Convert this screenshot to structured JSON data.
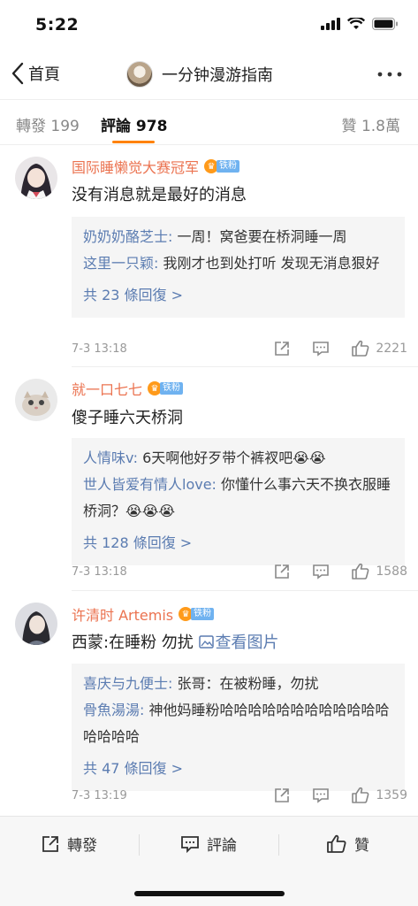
{
  "status": {
    "time": "5:22"
  },
  "nav": {
    "back_label": "首頁",
    "title": "一分钟漫游指南"
  },
  "tabs": {
    "repost": "轉發 199",
    "comments": "評論 978",
    "likes": "贊 1.8萬"
  },
  "comments": [
    {
      "name": "国际睡懒觉大赛冠军",
      "badge": "铁粉",
      "text": "没有消息就是最好的消息",
      "replies": [
        {
          "user": "奶奶奶酪芝士:",
          "text": " 一周！窝爸要在桥洞睡一周"
        },
        {
          "user": "这里一只颖:",
          "text": " 我刚才也到处打听 发现无消息狠好"
        }
      ],
      "more": "共 23 條回復 >",
      "time": "7-3 13:18",
      "likes": "2221"
    },
    {
      "name": "就一口七七",
      "badge": "铁粉",
      "text": "傻子睡六天桥洞",
      "replies": [
        {
          "user": "人情味v:",
          "text": " 6天啊他好歹带个裤衩吧😭😭"
        },
        {
          "user": "世人皆爱有情人love:",
          "text": " 你懂什么事六天不换衣服睡桥洞？😭😭😭"
        }
      ],
      "more": "共 128 條回復 >",
      "time": "7-3 13:18",
      "likes": "1588"
    },
    {
      "name": "许清时 Artemis",
      "badge": "铁粉",
      "text": "西蒙:在睡粉 勿扰 ",
      "link": "查看图片",
      "replies": [
        {
          "user": "喜庆与九便士:",
          "text": " 张哥：在被粉睡，勿扰"
        },
        {
          "user": "骨魚湯湯:",
          "text": " 神他妈睡粉哈哈哈哈哈哈哈哈哈哈哈哈哈哈哈哈"
        }
      ],
      "more": "共 47 條回復 >",
      "time": "7-3 13:19",
      "likes": "1359"
    }
  ],
  "toolbar": {
    "repost": "轉發",
    "comment": "評論",
    "like": "贊"
  },
  "colors": {
    "accent": "#ff8200",
    "name": "#eb7350",
    "link": "#5b7cb1"
  }
}
